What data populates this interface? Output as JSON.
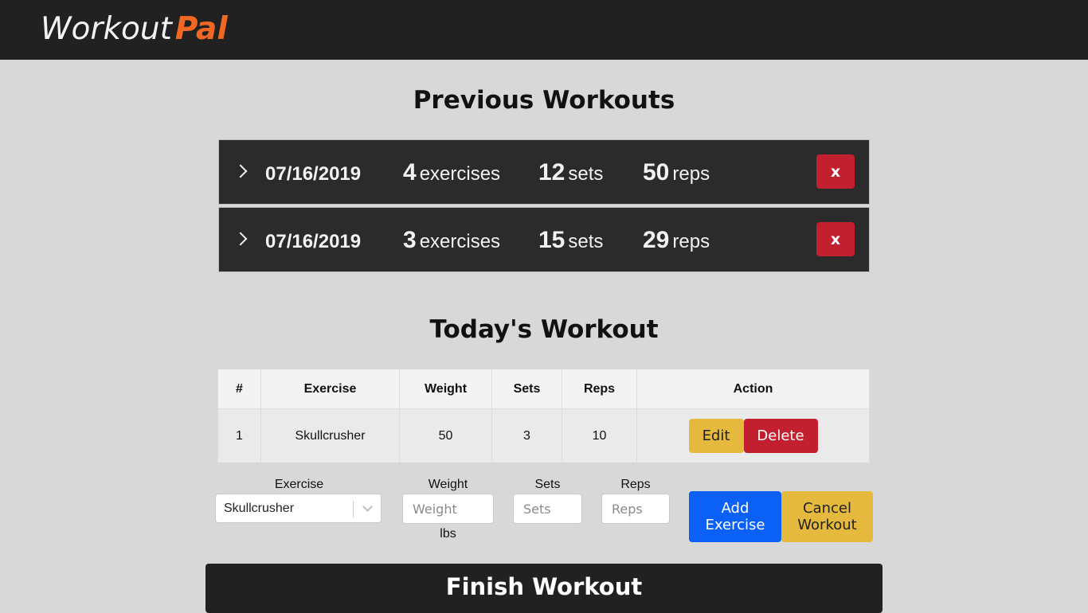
{
  "brand": {
    "part1": "Workout",
    "part2": "Pal"
  },
  "previous": {
    "title": "Previous Workouts",
    "workouts": [
      {
        "date": "07/16/2019",
        "exercises": "4",
        "exercises_unit": "exercises",
        "sets": "12",
        "sets_unit": "sets",
        "reps": "50",
        "reps_unit": "reps",
        "delete_label": "x"
      },
      {
        "date": "07/16/2019",
        "exercises": "3",
        "exercises_unit": "exercises",
        "sets": "15",
        "sets_unit": "sets",
        "reps": "29",
        "reps_unit": "reps",
        "delete_label": "x"
      }
    ]
  },
  "today": {
    "title": "Today's Workout",
    "columns": [
      "#",
      "Exercise",
      "Weight",
      "Sets",
      "Reps",
      "Action"
    ],
    "rows": [
      {
        "num": "1",
        "exercise": "Skullcrusher",
        "weight": "50",
        "sets": "3",
        "reps": "10"
      }
    ],
    "edit_label": "Edit",
    "delete_label": "Delete"
  },
  "form": {
    "exercise_label": "Exercise",
    "exercise_value": "Skullcrusher",
    "weight_label": "Weight",
    "weight_placeholder": "Weight",
    "weight_unit": "lbs",
    "sets_label": "Sets",
    "sets_placeholder": "Sets",
    "reps_label": "Reps",
    "reps_placeholder": "Reps",
    "add_line1": "Add",
    "add_line2": "Exercise",
    "cancel_line1": "Cancel",
    "cancel_line2": "Workout"
  },
  "finish_label": "Finish Workout",
  "colors": {
    "navbar": "#212121",
    "brand_accent": "#f26722",
    "danger": "#c3202f",
    "warning": "#e5b83e",
    "primary": "#0b60f5"
  },
  "icons": {
    "expand": "chevron-right-icon",
    "dropdown": "chevron-down-icon"
  }
}
